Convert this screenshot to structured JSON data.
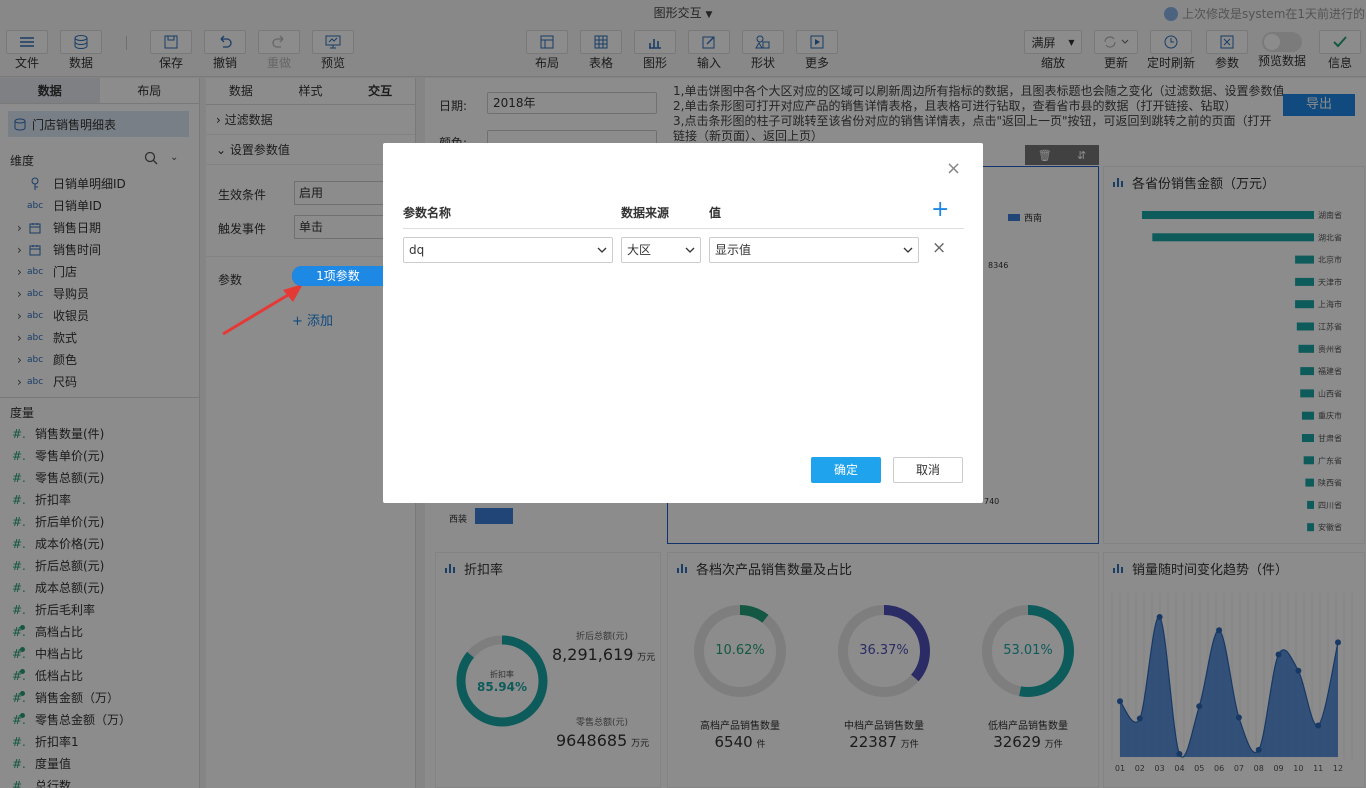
{
  "app": {
    "title": "图形交互",
    "last_modified": "上次修改是system在1天前进行的"
  },
  "toolbar": {
    "file": "文件",
    "data": "数据",
    "save": "保存",
    "undo": "撤销",
    "redo": "重做",
    "preview": "预览",
    "layout": "布局",
    "table": "表格",
    "chart": "图形",
    "input": "输入",
    "shape": "形状",
    "more": "更多",
    "zoom_value": "满屏",
    "zoom": "缩放",
    "refresh": "更新",
    "timed_refresh": "定时刷新",
    "params": "参数",
    "preview_data": "预览数据",
    "info": "信息"
  },
  "left_panel": {
    "tabs": [
      "数据",
      "布局"
    ],
    "dataset": "门店销售明细表",
    "dimension_header": "维度",
    "dimensions": [
      {
        "type": "key",
        "label": "日销单明细ID",
        "expand": false
      },
      {
        "type": "abc",
        "label": "日销单ID",
        "expand": false
      },
      {
        "type": "cal",
        "label": "销售日期",
        "expand": true
      },
      {
        "type": "cal",
        "label": "销售时间",
        "expand": true
      },
      {
        "type": "abc",
        "label": "门店",
        "expand": true
      },
      {
        "type": "abc",
        "label": "导购员",
        "expand": true
      },
      {
        "type": "abc",
        "label": "收银员",
        "expand": true
      },
      {
        "type": "abc",
        "label": "款式",
        "expand": true
      },
      {
        "type": "abc",
        "label": "颜色",
        "expand": true
      },
      {
        "type": "abc",
        "label": "尺码",
        "expand": true
      }
    ],
    "measure_header": "度量",
    "measures": [
      {
        "label": "销售数量(件)",
        "calc": false
      },
      {
        "label": "零售单价(元)",
        "calc": false
      },
      {
        "label": "零售总额(元)",
        "calc": false
      },
      {
        "label": "折扣率",
        "calc": false
      },
      {
        "label": "折后单价(元)",
        "calc": false
      },
      {
        "label": "成本价格(元)",
        "calc": false
      },
      {
        "label": "折后总额(元)",
        "calc": false
      },
      {
        "label": "成本总额(元)",
        "calc": false
      },
      {
        "label": "折后毛利率",
        "calc": false
      },
      {
        "label": "高档占比",
        "calc": true
      },
      {
        "label": "中档占比",
        "calc": true
      },
      {
        "label": "低档占比",
        "calc": true
      },
      {
        "label": "销售金额（万）",
        "calc": true
      },
      {
        "label": "零售总金额（万）",
        "calc": true
      },
      {
        "label": "折扣率1",
        "calc": false
      },
      {
        "label": "度量值",
        "calc": false
      },
      {
        "label": "总行数",
        "calc": false
      }
    ]
  },
  "config_panel": {
    "tabs": [
      "数据",
      "样式",
      "交互"
    ],
    "filter_data": "过滤数据",
    "set_params": "设置参数值",
    "condition_label": "生效条件",
    "condition_value": "启用",
    "event_label": "触发事件",
    "event_value": "单击",
    "param_label": "参数",
    "param_button": "1项参数",
    "add": "添加"
  },
  "canvas": {
    "date_label": "日期:",
    "date_value": "2018年",
    "color_label": "颜色:",
    "notes": [
      "1,单击饼图中各个大区对应的区域可以刷新周边所有指标的数据，且图表标题也会随之变化（过滤数据、设置参数值）",
      "2,单击条形图可打开对应产品的销售详情表格，且表格可进行钻取，查看省市县的数据（打开链接、钻取）",
      "3,点击条形图的柱子可跳转至该省份对应的销售详情表，点击\"返回上一页\"按钮，可返回到跳转之前的页面（打开链接（新页面）、返回上页）"
    ],
    "export": "导出",
    "pie_legend": "西南",
    "pie_label1": "8346",
    "pie_label2": "740",
    "bar_left_label": "西装",
    "province_title": "各省份销售金额（万元）",
    "provinces": [
      "湖南省",
      "湖北省",
      "北京市",
      "天津市",
      "上海市",
      "江苏省",
      "贵州省",
      "福建省",
      "山西省",
      "重庆市",
      "甘肃省",
      "广东省",
      "陕西省",
      "四川省",
      "安徽省"
    ],
    "province_values": [
      100,
      94,
      11,
      11,
      11,
      10,
      9,
      8,
      8,
      7,
      7,
      6,
      5,
      4,
      4
    ],
    "discount_title": "折扣率",
    "discount_ring_label": "折扣率",
    "discount_value": "85.94%",
    "discount_ratio": 0.8594,
    "after_discount_label": "折后总额(元)",
    "after_discount_value": "8,291,619",
    "after_discount_unit": "万元",
    "retail_label": "零售总额(元)",
    "retail_value": "9648685",
    "retail_unit": "万元",
    "tier_title": "各档次产品销售数量及占比",
    "tiers": [
      {
        "pct": "10.62%",
        "ratio": 0.1062,
        "color": "#26a17a",
        "label": "高档产品销售数量",
        "value": "6540",
        "unit": "件"
      },
      {
        "pct": "36.37%",
        "ratio": 0.3637,
        "color": "#4f4fb8",
        "label": "中档产品销售数量",
        "value": "22387",
        "unit": "万件"
      },
      {
        "pct": "53.01%",
        "ratio": 0.5301,
        "color": "#1aa6a6",
        "label": "低档产品销售数量",
        "value": "32629",
        "unit": "万件"
      }
    ],
    "trend_title": "销量随时间变化趋势（件）",
    "trend_months": [
      "01",
      "02",
      "03",
      "04",
      "05",
      "06",
      "07",
      "08",
      "09",
      "10",
      "11",
      "12"
    ],
    "trend_values": [
      55,
      38,
      138,
      3,
      50,
      125,
      39,
      7,
      101,
      85,
      31,
      113
    ]
  },
  "dialog": {
    "col_name": "参数名称",
    "col_source": "数据来源",
    "col_value": "值",
    "row_name": "dq",
    "row_source": "大区",
    "row_value": "显示值",
    "ok": "确定",
    "cancel": "取消"
  },
  "colors": {
    "accent": "#1e88e5",
    "ok_button": "#1fa3ec",
    "teal": "#1aa6a6",
    "arrow": "#e53935"
  }
}
